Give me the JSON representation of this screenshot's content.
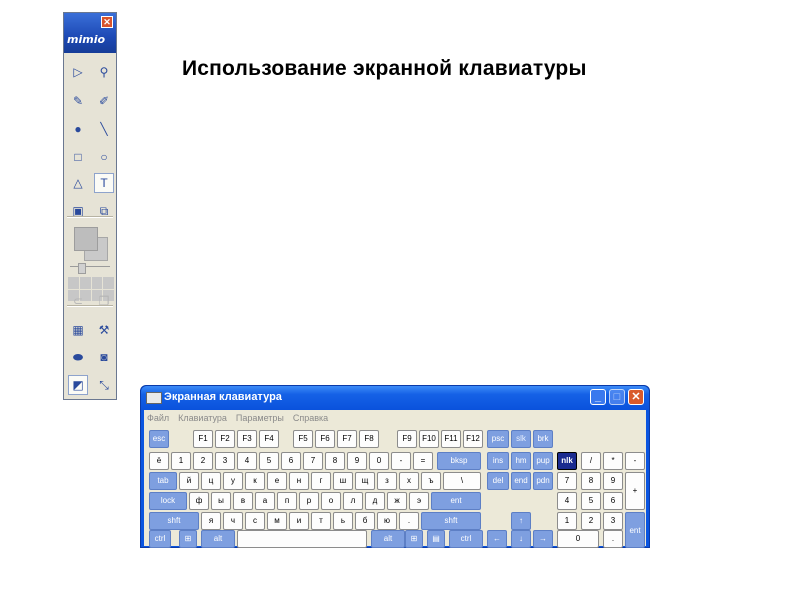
{
  "slide": {
    "title": "Использование экранной клавиатуры"
  },
  "mimio": {
    "close_label": "✕",
    "logo": "mimio",
    "rows": [
      [
        {
          "name": "select-arrow-icon",
          "glyph": "▷"
        },
        {
          "name": "magnifier-icon",
          "glyph": "⚲"
        }
      ],
      [
        {
          "name": "pen-icon",
          "glyph": "✎"
        },
        {
          "name": "highlighter-icon",
          "glyph": "✐"
        }
      ],
      [
        {
          "name": "sphere-icon",
          "glyph": "●"
        },
        {
          "name": "line-icon",
          "glyph": "╲"
        }
      ],
      [
        {
          "name": "rectangle-icon",
          "glyph": "□"
        },
        {
          "name": "circle-icon",
          "glyph": "○"
        }
      ],
      [
        {
          "name": "triangle-icon",
          "glyph": "△"
        },
        {
          "name": "text-tool-icon",
          "glyph": "T"
        }
      ],
      [
        {
          "name": "insert-image-icon",
          "glyph": "▣"
        },
        {
          "name": "screen-capture-icon",
          "glyph": "⧉"
        }
      ]
    ],
    "bottom_rows": [
      [
        {
          "name": "lasso-icon",
          "glyph": "⊂"
        },
        {
          "name": "layer-icon",
          "glyph": "❐"
        }
      ],
      [
        {
          "name": "gallery-icon",
          "glyph": "▦"
        },
        {
          "name": "tools-icon",
          "glyph": "⚒"
        }
      ],
      [
        {
          "name": "eraser-icon",
          "glyph": "⬬"
        },
        {
          "name": "spotlight-icon",
          "glyph": "◙"
        }
      ],
      [
        {
          "name": "reveal-icon",
          "glyph": "◩"
        },
        {
          "name": "fullscreen-icon",
          "glyph": "⤡"
        }
      ]
    ]
  },
  "osk": {
    "title": "Экранная клавиатура",
    "window_buttons": {
      "minimize": "_",
      "maximize": "□",
      "close": "✕"
    },
    "menu": [
      "Файл",
      "Клавиатура",
      "Параметры",
      "Справка"
    ],
    "rows": {
      "fn": [
        "esc",
        "F1",
        "F2",
        "F3",
        "F4",
        "F5",
        "F6",
        "F7",
        "F8",
        "F9",
        "F10",
        "F11",
        "F12",
        "psc",
        "slk",
        "brk"
      ],
      "num": [
        "ё",
        "1",
        "2",
        "3",
        "4",
        "5",
        "6",
        "7",
        "8",
        "9",
        "0",
        "-",
        "=",
        "bksp",
        "ins",
        "hm",
        "pup",
        "nlk",
        "/",
        "*",
        "-"
      ],
      "top": [
        "tab",
        "й",
        "ц",
        "у",
        "к",
        "е",
        "н",
        "г",
        "ш",
        "щ",
        "з",
        "х",
        "ъ",
        "\\",
        "del",
        "end",
        "pdn",
        "7",
        "8",
        "9",
        "+"
      ],
      "home": [
        "lock",
        "ф",
        "ы",
        "в",
        "а",
        "п",
        "р",
        "о",
        "л",
        "д",
        "ж",
        "э",
        "ent",
        "4",
        "5",
        "6"
      ],
      "shift": [
        "shft",
        "я",
        "ч",
        "с",
        "м",
        "и",
        "т",
        "ь",
        "б",
        "ю",
        ".",
        "shft",
        "↑",
        "1",
        "2",
        "3",
        "ent"
      ],
      "bottom": [
        "ctrl",
        "win",
        "alt",
        "",
        "alt",
        "win",
        "menu",
        "ctrl",
        "←",
        "↓",
        "→",
        "0",
        "."
      ]
    }
  }
}
